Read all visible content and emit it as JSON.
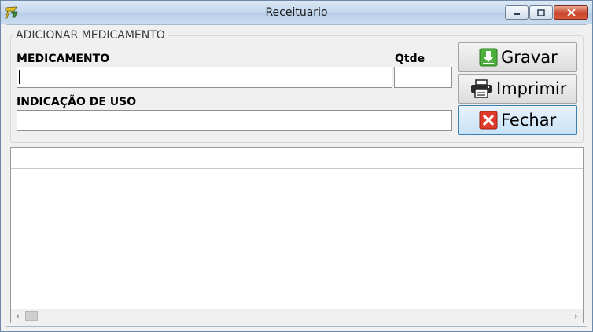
{
  "window": {
    "title": "Receituario"
  },
  "form": {
    "group_title": "ADICIONAR MEDICAMENTO",
    "medicamento_label": "MEDICAMENTO",
    "medicamento_value": "",
    "qtde_label": "Qtde",
    "qtde_value": "",
    "indicacao_label": "INDICAÇÃO DE USO",
    "indicacao_value": ""
  },
  "buttons": {
    "gravar": "Gravar",
    "imprimir": "Imprimir",
    "fechar": "Fechar"
  },
  "icons": {
    "app": "app-logo-icon",
    "gravar": "save-download-icon",
    "imprimir": "printer-icon",
    "fechar": "close-x-icon"
  },
  "colors": {
    "gravar_icon": "#4caf3c",
    "fechar_icon": "#e03a2a",
    "accent_border": "#3c7fb1"
  }
}
